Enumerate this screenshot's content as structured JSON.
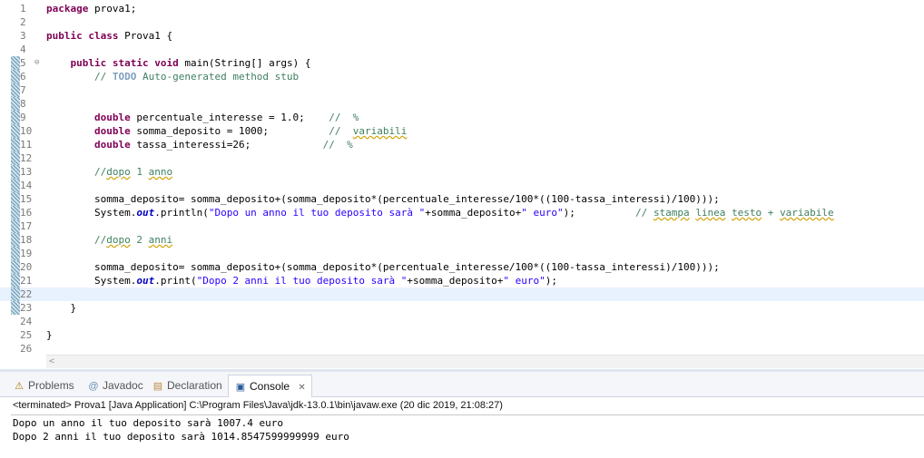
{
  "editor": {
    "lines": [
      {
        "n": "1",
        "html": "<span class=\"kw\">package</span> prova1;"
      },
      {
        "n": "2",
        "html": ""
      },
      {
        "n": "3",
        "html": "<span class=\"kw\">public</span> <span class=\"kw\">class</span> Prova1 {"
      },
      {
        "n": "4",
        "html": ""
      },
      {
        "n": "5",
        "html": "    <span class=\"kw\">public</span> <span class=\"kw\">static</span> <span class=\"kw\">void</span> main(String[] args) {",
        "fold": "⊖"
      },
      {
        "n": "6",
        "html": "        <span class=\"com\">// <span class=\"todo\">TODO</span> Auto-generated method stub</span>"
      },
      {
        "n": "7",
        "html": ""
      },
      {
        "n": "8",
        "html": ""
      },
      {
        "n": "9",
        "html": "        <span class=\"kw\">double</span> percentuale_interesse = 1.0;    <span class=\"com\">//  %</span>"
      },
      {
        "n": "10",
        "html": "        <span class=\"kw\">double</span> somma_deposito = 1000;          <span class=\"com\">//  <span class=\"sq\">variabili</span></span>"
      },
      {
        "n": "11",
        "html": "        <span class=\"kw\">double</span> tassa_interessi=26;            <span class=\"com\">//  %</span>"
      },
      {
        "n": "12",
        "html": ""
      },
      {
        "n": "13",
        "html": "        <span class=\"com\">//<span class=\"sq\">dopo</span> 1 <span class=\"sq\">anno</span></span>"
      },
      {
        "n": "14",
        "html": ""
      },
      {
        "n": "15",
        "html": "        somma_deposito= somma_deposito+(somma_deposito*(percentuale_interesse/100*((100-tassa_interessi)/100)));"
      },
      {
        "n": "16",
        "html": "        System.<span class=\"field\">out</span>.println(<span class=\"str\">\"Dopo un anno il tuo deposito sarà \"</span>+somma_deposito+<span class=\"str\">\" euro\"</span>);          <span class=\"com\">// <span class=\"sq\">stampa</span> <span class=\"sq\">linea</span> <span class=\"sq\">testo</span> + <span class=\"sq\">variabile</span></span>"
      },
      {
        "n": "17",
        "html": ""
      },
      {
        "n": "18",
        "html": "        <span class=\"com\">//<span class=\"sq\">dopo</span> 2 <span class=\"sq\">anni</span></span>"
      },
      {
        "n": "19",
        "html": ""
      },
      {
        "n": "20",
        "html": "        somma_deposito= somma_deposito+(somma_deposito*(percentuale_interesse/100*((100-tassa_interessi)/100)));"
      },
      {
        "n": "21",
        "html": "        System.<span class=\"field\">out</span>.print(<span class=\"str\">\"Dopo 2 anni il tuo deposito sarà \"</span>+somma_deposito+<span class=\"str\">\" euro\"</span>);"
      },
      {
        "n": "22",
        "html": "",
        "current": true
      },
      {
        "n": "23",
        "html": "    }"
      },
      {
        "n": "24",
        "html": ""
      },
      {
        "n": "25",
        "html": "}"
      },
      {
        "n": "26",
        "html": ""
      }
    ]
  },
  "tabs": [
    {
      "label": "Problems",
      "icon": "problems-icon",
      "glyph": "⚠"
    },
    {
      "label": "Javadoc",
      "icon": "javadoc-icon",
      "glyph": "@"
    },
    {
      "label": "Declaration",
      "icon": "declaration-icon",
      "glyph": "▤"
    },
    {
      "label": "Console",
      "icon": "console-icon",
      "glyph": "▣",
      "active": true,
      "close": "✕"
    }
  ],
  "console": {
    "header": "<terminated> Prova1 [Java Application] C:\\Program Files\\Java\\jdk-13.0.1\\bin\\javaw.exe (20 dic 2019, 21:08:27)",
    "output": [
      "Dopo un anno il tuo deposito sarà 1007.4 euro",
      "Dopo 2 anni il tuo deposito sarà 1014.8547599999999 euro"
    ]
  },
  "scroll_arrow": "<"
}
